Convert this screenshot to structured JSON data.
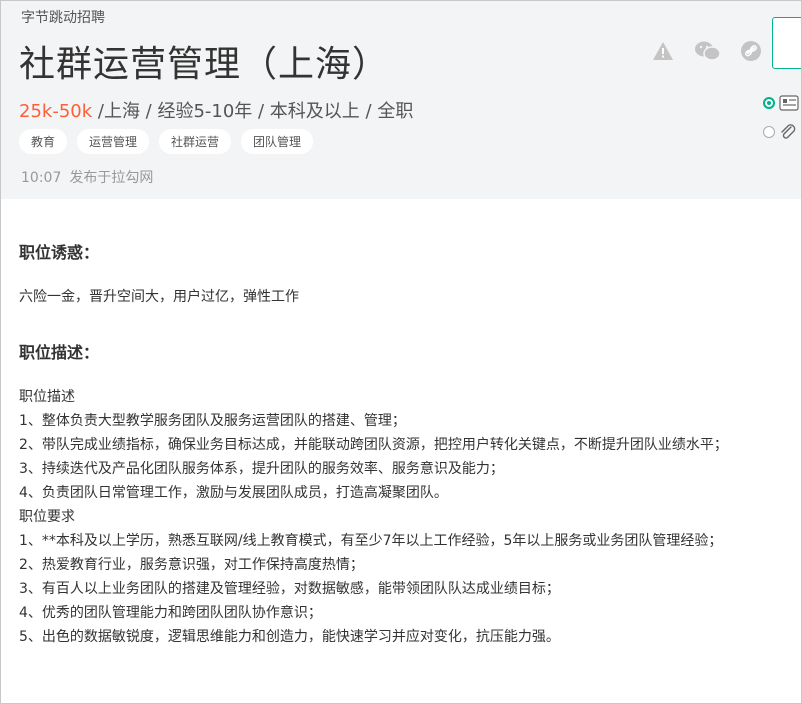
{
  "company": "字节跳动招聘",
  "job_title": "社群运营管理（上海）",
  "meta": {
    "salary": "25k-50k",
    "rest": " /上海 / 经验5-10年 / 本科及以上 / 全职"
  },
  "tags": [
    "教育",
    "运营管理",
    "社群运营",
    "团队管理"
  ],
  "publish": {
    "time": "10:07",
    "source": "发布于拉勾网"
  },
  "sections": {
    "perks_title": "职位诱惑：",
    "perks": "六险一金，晋升空间大，用户过亿，弹性工作",
    "desc_title": "职位描述：",
    "lines": [
      "职位描述",
      "1、整体负责大型教学服务团队及服务运营团队的搭建、管理；",
      "2、带队完成业绩指标，确保业务目标达成，并能联动跨团队资源，把控用户转化关键点，不断提升团队业绩水平；",
      "3、持续迭代及产品化团队服务体系，提升团队的服务效率、服务意识及能力；",
      "4、负责团队日常管理工作，激励与发展团队成员，打造高凝聚团队。",
      "职位要求",
      "1、**本科及以上学历，熟悉互联网/线上教育模式，有至少7年以上工作经验，5年以上服务或业务团队管理经验；",
      "2、热爱教育行业，服务意识强，对工作保持高度热情；",
      "3、有百人以上业务团队的搭建及管理经验，对数据敏感，能带领团队队达成业绩目标；",
      "4、优秀的团队管理能力和跨团队团队协作意识；",
      "5、出色的数据敏锐度，逻辑思维能力和创造力，能快速学习并应对变化，抗压能力强。"
    ]
  },
  "icons": [
    "warning-icon",
    "wechat-icon",
    "link-icon",
    "resume-icon",
    "attachment-icon"
  ],
  "colors": {
    "salary": "#fd5f39",
    "accent": "#00b38a",
    "header_bg": "#f3f4f5"
  }
}
